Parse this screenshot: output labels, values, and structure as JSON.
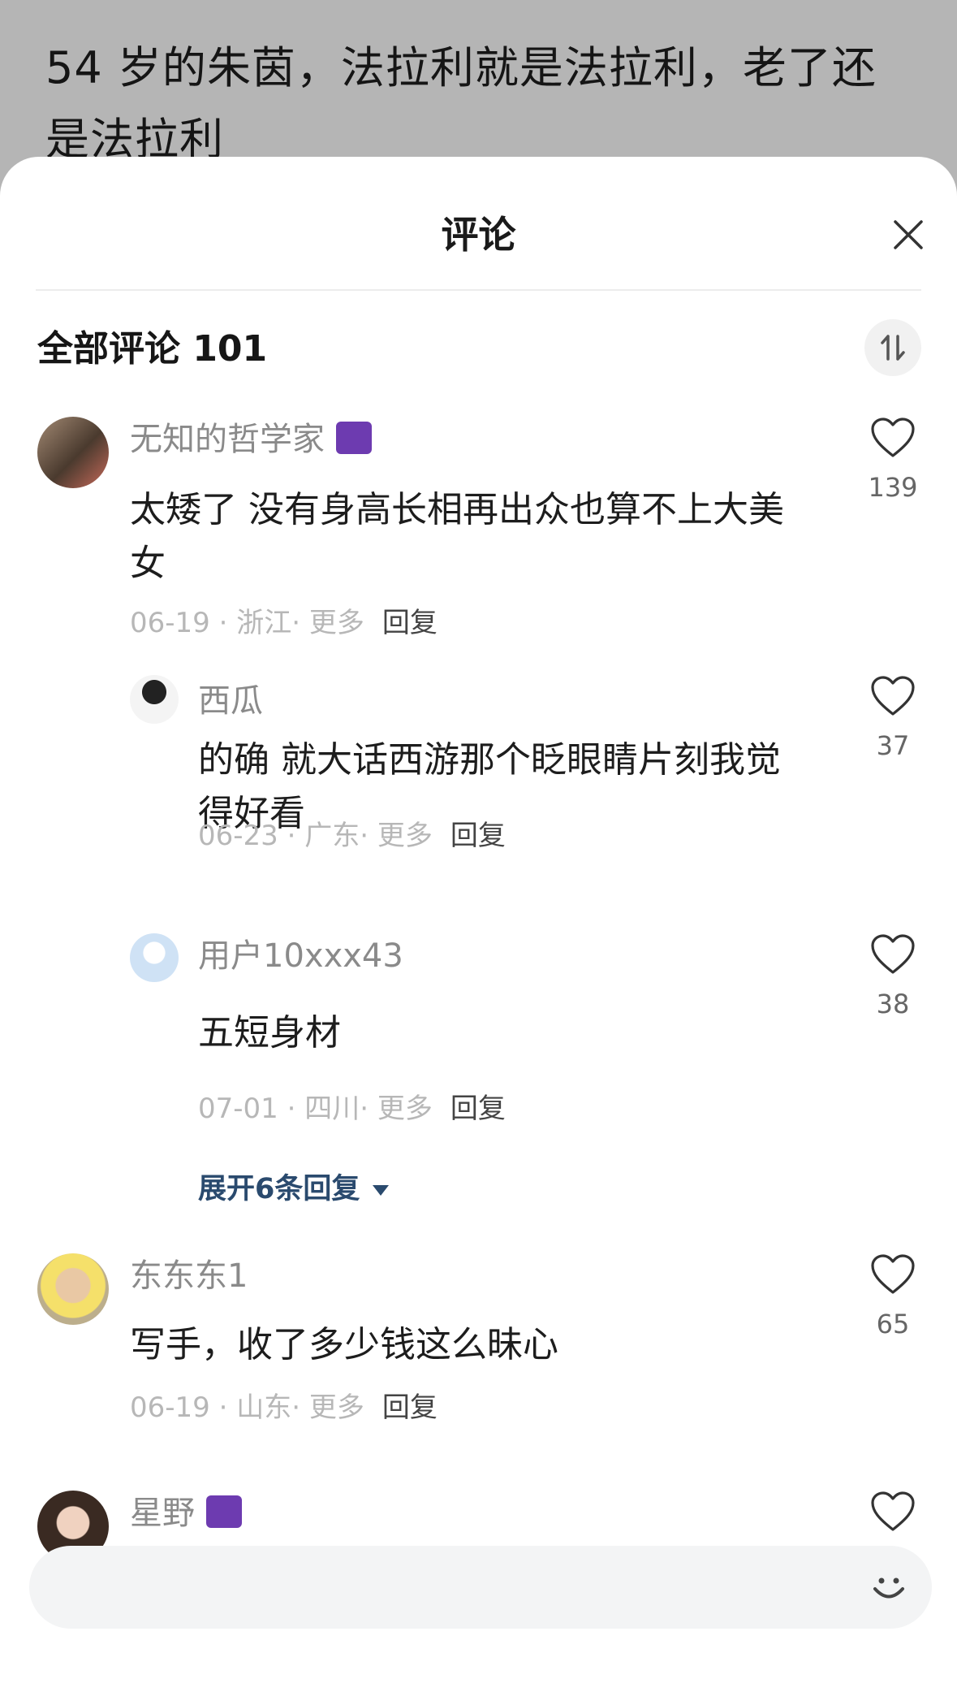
{
  "background_article": {
    "title": "54 岁的朱茵，法拉利就是法拉利，老了还是法拉利"
  },
  "sheet": {
    "title": "评论",
    "close_icon": "close-icon"
  },
  "comments_header": {
    "label": "全部评论 101",
    "sort_icon": "sort-icon"
  },
  "comments": [
    {
      "name": "无知的哲学家",
      "has_badge": true,
      "text_line1": "太矮了 没有身高长相再出众也算不上大美",
      "text_line2": "女",
      "date": "06-19",
      "location": "浙江",
      "more": "更多",
      "reply": "回复",
      "likes": "139"
    },
    {
      "name": "西瓜",
      "text_line1": "的确 就大话西游那个眨眼睛片刻我觉",
      "text_line2": "得好看",
      "date": "06-23",
      "location": "广东",
      "more": "更多",
      "reply": "回复",
      "likes": "37"
    },
    {
      "name": "用户10xxx43",
      "text_line1": "五短身材",
      "date": "07-01",
      "location": "四川",
      "more": "更多",
      "reply": "回复",
      "likes": "38"
    },
    {
      "name": "东东东1",
      "text_line1": "写手，收了多少钱这么昧心",
      "date": "06-19",
      "location": "山东",
      "more": "更多",
      "reply": "回复",
      "likes": "65"
    },
    {
      "name": "星野",
      "has_badge": true
    }
  ],
  "expand_replies": "展开6条回复",
  "input": {
    "placeholder": "",
    "emoji_icon": "smile-icon"
  },
  "colors": {
    "backdrop": "#b5b5b5",
    "sheet": "#ffffff",
    "link_blue": "#2a4a6e",
    "meta_gray": "#b7b7b7"
  }
}
